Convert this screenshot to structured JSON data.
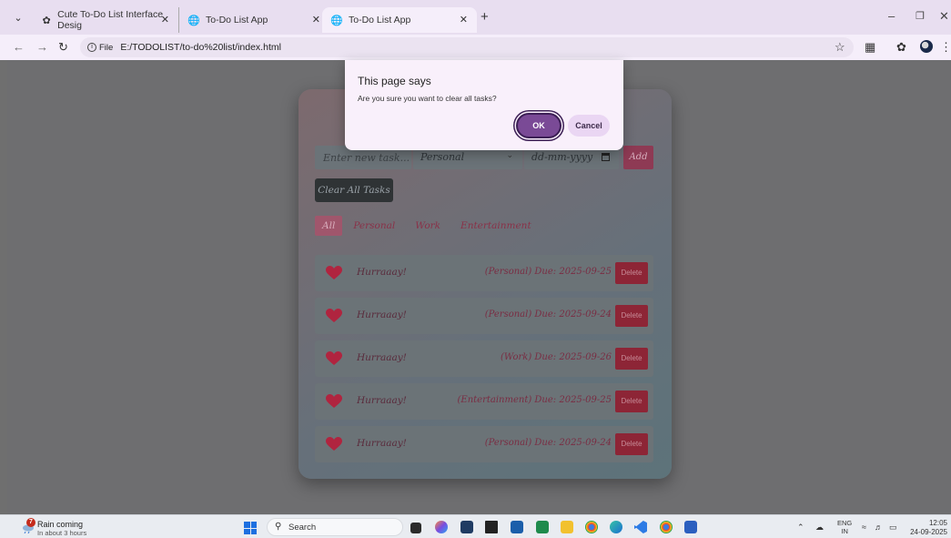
{
  "browser": {
    "tabs": [
      {
        "title": "Cute To-Do List Interface Desig",
        "icon": "openai-icon"
      },
      {
        "title": "To-Do List App",
        "icon": "globe-icon"
      },
      {
        "title": "To-Do List App",
        "icon": "globe-icon",
        "active": true
      }
    ],
    "address": {
      "scheme_chip": "File",
      "url": "E:/TODOLIST/to-do%20list/index.html"
    }
  },
  "app": {
    "task_placeholder": "Enter new task...",
    "category_value": "Personal",
    "date_placeholder": "dd-mm-yyyy",
    "add_label": "Add",
    "clear_label": "Clear All Tasks",
    "filters": [
      "All",
      "Personal",
      "Work",
      "Entertainment"
    ],
    "active_filter": "All",
    "tasks": [
      {
        "name": "Hurraaay!",
        "meta": "(Personal)  Due: 2025-09-25",
        "delete": "Delete"
      },
      {
        "name": "Hurraaay!",
        "meta": "(Personal)  Due: 2025-09-24",
        "delete": "Delete"
      },
      {
        "name": "Hurraaay!",
        "meta": "(Work)  Due: 2025-09-26",
        "delete": "Delete"
      },
      {
        "name": "Hurraaay!",
        "meta": "(Entertainment)  Due: 2025-09-25",
        "delete": "Delete"
      },
      {
        "name": "Hurraaay!",
        "meta": "(Personal)  Due: 2025-09-24",
        "delete": "Delete"
      }
    ]
  },
  "dialog": {
    "title": "This page says",
    "message": "Are you sure you want to clear all tasks?",
    "ok_label": "OK",
    "cancel_label": "Cancel"
  },
  "taskbar": {
    "weather_badge": "7",
    "weather_title": "Rain coming",
    "weather_sub": "In about 3 hours",
    "search_label": "Search",
    "lang_top": "ENG",
    "lang_bottom": "IN",
    "time": "12:05",
    "date": "24-09-2025"
  },
  "colors": {
    "accent": "#7a4a96",
    "heart": "#b0243f",
    "delete": "#8d2536"
  }
}
